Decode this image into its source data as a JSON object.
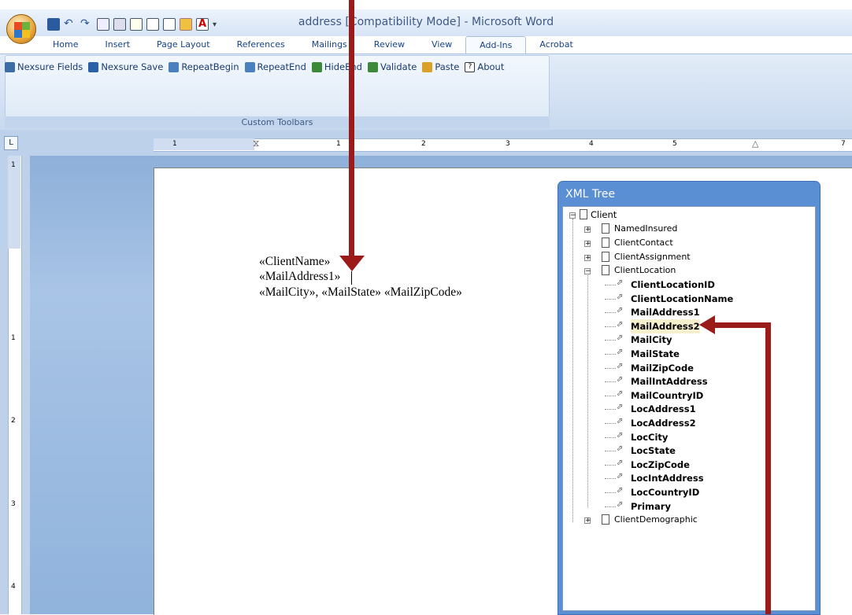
{
  "window": {
    "title": "address [Compatibility Mode] - Microsoft Word"
  },
  "quick_access": {
    "icons": [
      "save-icon",
      "undo-icon",
      "redo-icon",
      "copy-icon",
      "print-icon",
      "print-preview-icon",
      "edit-icon",
      "new-document-icon",
      "open-folder-icon",
      "font-color-icon",
      "customize-dropdown-icon"
    ]
  },
  "ribbon": {
    "tabs": [
      "Home",
      "Insert",
      "Page Layout",
      "References",
      "Mailings",
      "Review",
      "View",
      "Add-Ins",
      "Acrobat"
    ],
    "active_tab": "Add-Ins",
    "group_label": "Custom Toolbars",
    "buttons": [
      {
        "label": "Nexsure Fields",
        "icon": "fields-icon",
        "color": "#3a6ea5"
      },
      {
        "label": "Nexsure Save",
        "icon": "save-icon",
        "color": "#2b5fa8"
      },
      {
        "label": "RepeatBegin",
        "icon": "repeat-begin-icon",
        "color": "#4a7fc0"
      },
      {
        "label": "RepeatEnd",
        "icon": "repeat-end-icon",
        "color": "#4a7fc0"
      },
      {
        "label": "HideEnd",
        "icon": "hide-end-icon",
        "color": "#3a8a3a"
      },
      {
        "label": "Validate",
        "icon": "validate-icon",
        "color": "#3a8a3a"
      },
      {
        "label": "Paste",
        "icon": "paste-icon",
        "color": "#d9a12a"
      },
      {
        "label": "About",
        "icon": "help-icon",
        "color": "#e9e9e9"
      }
    ]
  },
  "ruler": {
    "marks": [
      "1",
      "1",
      "2",
      "3",
      "4",
      "5",
      "7"
    ]
  },
  "vruler": {
    "marks": [
      "1",
      "1",
      "2",
      "3",
      "4"
    ]
  },
  "document": {
    "lines": [
      "«ClientName»",
      "«MailAddress1»",
      "«MailCity», «MailState» «MailZipCode»"
    ]
  },
  "xml_tree": {
    "title": "XML Tree",
    "root": "Client",
    "children": [
      "NamedInsured",
      "ClientContact",
      "ClientAssignment",
      "ClientLocation",
      "ClientDemographic"
    ],
    "location_fields": [
      "ClientLocationID",
      "ClientLocationName",
      "MailAddress1",
      "MailAddress2",
      "MailCity",
      "MailState",
      "MailZipCode",
      "MailIntAddress",
      "MailCountryID",
      "LocAddress1",
      "LocAddress2",
      "LocCity",
      "LocState",
      "LocZipCode",
      "LocIntAddress",
      "LocCountryID",
      "Primary"
    ],
    "selected": "MailAddress2"
  },
  "colors": {
    "arrow": "#9b1b1b",
    "ribbon_text": "#15428b",
    "panel_title": "#5b8fd3"
  }
}
